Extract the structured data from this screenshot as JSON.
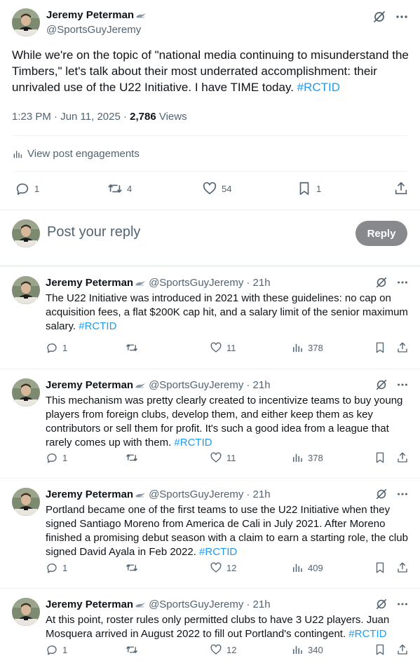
{
  "author": {
    "name": "Jeremy Peterman",
    "handle": "@SportsGuyJeremy"
  },
  "colors": {
    "link": "#1d9bf0",
    "muted": "#536471",
    "text": "#0f1419",
    "divider": "#eff3f4",
    "reply_button": "#87898c"
  },
  "main_post": {
    "text": "While we're on the topic of \"national media continuing to misunderstand the Timbers,\" let's talk about their most underrated accomplishment: their unrivaled use of the U22 Initiative. I have TIME today. ",
    "hashtag": "#RCTID",
    "time": "1:23 PM · Jun 11, 2025 · ",
    "views_count": "2,786",
    "views_label": " Views",
    "engagements_label": "View post engagements",
    "replies": "1",
    "reposts": "4",
    "likes": "54",
    "bookmarks": "1"
  },
  "reply_box": {
    "placeholder": "Post your reply",
    "button_label": "Reply"
  },
  "thread": [
    {
      "time": "· 21h",
      "text": "The U22 Initiative was introduced in 2021 with these guidelines: no cap on acquisition fees, a flat $200K cap hit, and a salary limit of the senior maximum salary. ",
      "hashtag": "#RCTID",
      "replies": "1",
      "likes": "11",
      "views": "378"
    },
    {
      "time": "· 21h",
      "text": "This mechanism was pretty clearly created to incentivize teams to buy young players from foreign clubs, develop them, and either keep them as key contributors or sell them for profit. It's such a good idea from a league that rarely comes up with them. ",
      "hashtag": "#RCTID",
      "replies": "1",
      "likes": "11",
      "views": "378"
    },
    {
      "time": "· 21h",
      "text": "Portland became one of the first teams to use the U22 Initiative when they signed Santiago Moreno from America de Cali in July 2021. After Moreno finished a promising debut season with a claim to earn a starting role, the club signed David Ayala in Feb 2022. ",
      "hashtag": "#RCTID",
      "replies": "1",
      "likes": "12",
      "views": "409"
    },
    {
      "time": "· 21h",
      "text": "At this point, roster rules only permitted clubs to have 3 U22 players. Juan Mosquera arrived in August 2022 to fill out Portland's contingent. ",
      "hashtag": "#RCTID",
      "replies": "1",
      "likes": "12",
      "views": "340"
    }
  ]
}
